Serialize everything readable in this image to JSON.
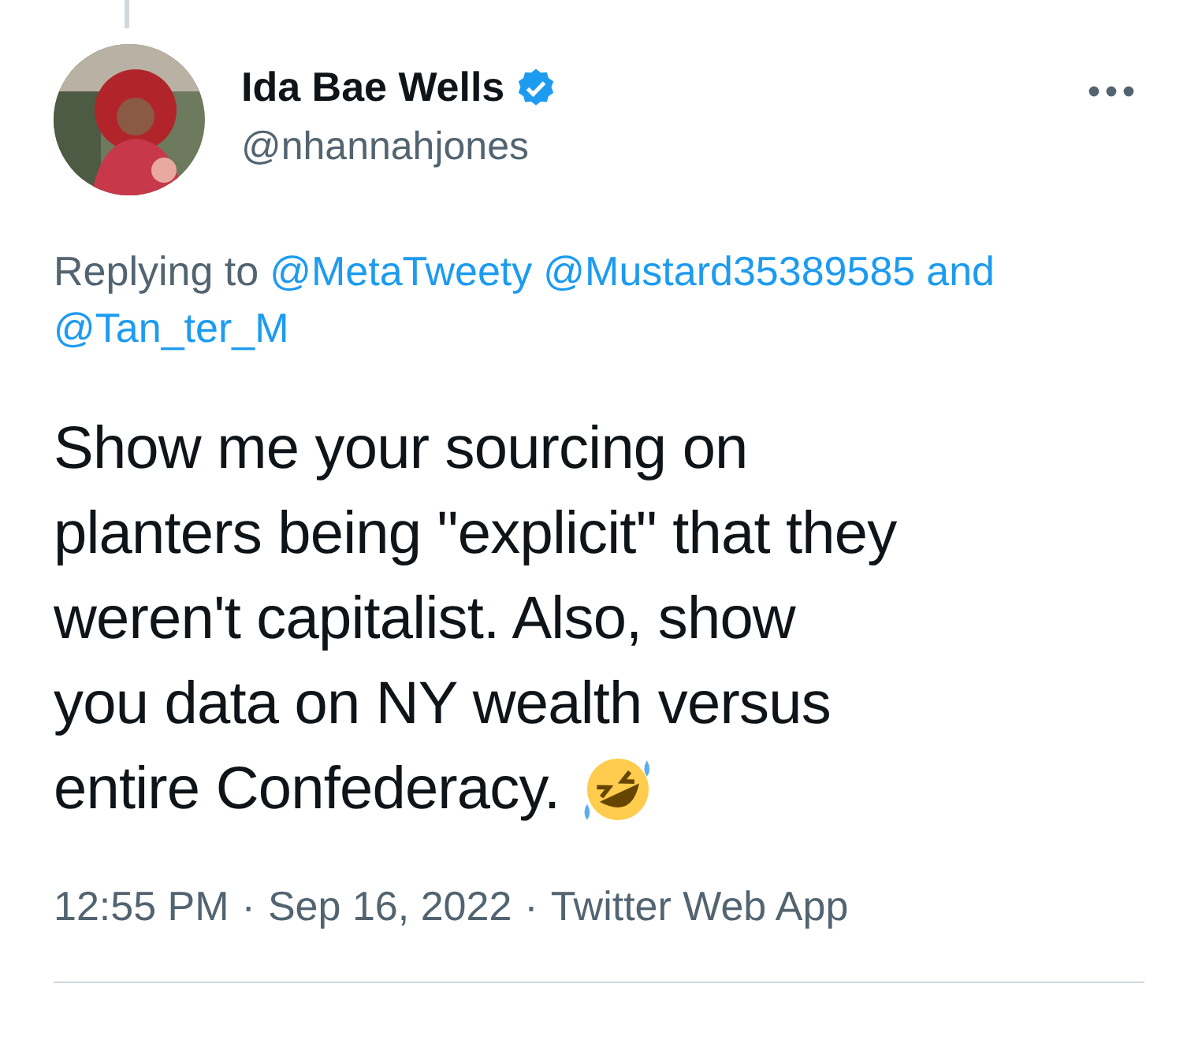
{
  "author": {
    "name": "Ida Bae Wells",
    "verified": true,
    "handle": "@nhannahjones"
  },
  "replying": {
    "prefix": "Replying to",
    "mentions": [
      "@MetaTweety",
      "@Mustard35389585"
    ],
    "conjunction": "and",
    "last": "@Tan_ter_M"
  },
  "text_lines": [
    "Show me your sourcing on",
    "planters being \"explicit\" that they",
    "weren't capitalist. Also, show",
    "you data on NY wealth versus",
    "entire Confederacy."
  ],
  "meta": [
    "12:55 PM",
    "Sep 16, 2022",
    "Twitter Web App"
  ],
  "meta_separator": "·"
}
